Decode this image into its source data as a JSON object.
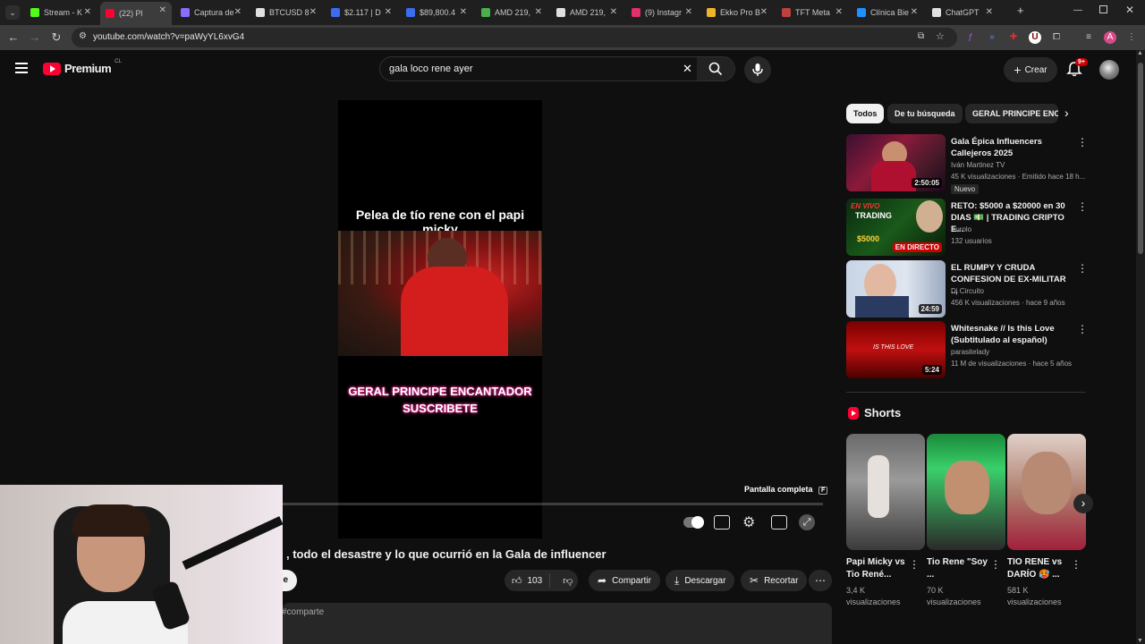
{
  "browser": {
    "tabs": [
      {
        "label": "Stream - K",
        "color": "#53fc18"
      },
      {
        "label": "(22) Pl",
        "color": "#ff0033"
      },
      {
        "label": "Captura de",
        "color": "#8a6cff"
      },
      {
        "label": "BTCUSD 8",
        "color": "#e0e0e0"
      },
      {
        "label": "$2.117 | D",
        "color": "#3a6df0"
      },
      {
        "label": "$89,800.4",
        "color": "#3a6df0"
      },
      {
        "label": "AMD 219,",
        "color": "#48b04c"
      },
      {
        "label": "AMD 219,",
        "color": "#e0e0e0"
      },
      {
        "label": "(9) Instagr",
        "color": "#e1306c"
      },
      {
        "label": "Ekko Pro B",
        "color": "#f0b429"
      },
      {
        "label": "TFT Meta",
        "color": "#c04040"
      },
      {
        "label": "Clínica Bie",
        "color": "#1e90ff"
      },
      {
        "label": "ChatGPT",
        "color": "#e0e0e0"
      }
    ],
    "url": "youtube.com/watch?v=paWyYL6xvG4"
  },
  "youtube": {
    "logo_text": "Premium",
    "logo_badge": "CL",
    "search_query": "gala loco rene ayer",
    "create_label": "Crear",
    "notif_count": "9+"
  },
  "player": {
    "overlay_title": "Pelea de tío rene con el papi micky",
    "pink_line1": "GERAL PRINCIPE ENCANTADOR",
    "pink_line2": "SUSCRIBETE",
    "fullscreen_tooltip": "Pantalla completa",
    "fullscreen_key": "F"
  },
  "video": {
    "title": ", todo el desastre y lo que ocurrió en la Gala de influencer",
    "likes": "103",
    "share_label": "Compartir",
    "download_label": "Descargar",
    "clip_label": "Recortar",
    "hashtag": "#comparte",
    "subscribe_partial": "e"
  },
  "sidebar": {
    "chips": [
      "Todos",
      "De tu búsqueda",
      "GERAL PRINCIPE ENC"
    ],
    "recos": [
      {
        "title": "Gala Épica Influencers Callejeros 2025",
        "channel": "Iván Martinez TV",
        "meta": "45 K visualizaciones · Emitido hace 18 h...",
        "badge": "Nuevo",
        "duration": "2:50:05"
      },
      {
        "title": "RETO: $5000 a $20000 en 30 DIAS 💵 | TRADING CRIPTO E...",
        "channel": "Aurolo",
        "meta": "132 usuarios",
        "badge": "",
        "duration": "EN DIRECTO",
        "thumb_text1": "EN VIVO",
        "thumb_text2": "TRADING",
        "thumb_text3": "$5000"
      },
      {
        "title": "EL RUMPY Y CRUDA CONFESION DE EX-MILITAR ...",
        "channel": "Dj Circuito",
        "meta": "456 K visualizaciones · hace 9 años",
        "badge": "",
        "duration": "24:59"
      },
      {
        "title": "Whitesnake // Is this Love (Subtitulado al español)",
        "channel": "parasitelady",
        "meta": "11 M de visualizaciones · hace 5 años",
        "badge": "",
        "duration": "5:24",
        "thumb_text1": "IS THIS LOVE"
      }
    ],
    "shorts_heading": "Shorts",
    "shorts": [
      {
        "title": "Papi Micky vs Tio René...",
        "views": "3,4 K visualizaciones"
      },
      {
        "title": "Tio Rene \"Soy ...",
        "views": "70 K visualizaciones"
      },
      {
        "title": "TIO RENE vs DARÍO 🥵 ...",
        "views": "581 K visualizaciones"
      }
    ]
  },
  "colors": {
    "youtube_red": "#ff0033",
    "live_red": "#cc0000",
    "chip_active_bg": "#f1f1f1",
    "chip_bg": "#272727"
  }
}
